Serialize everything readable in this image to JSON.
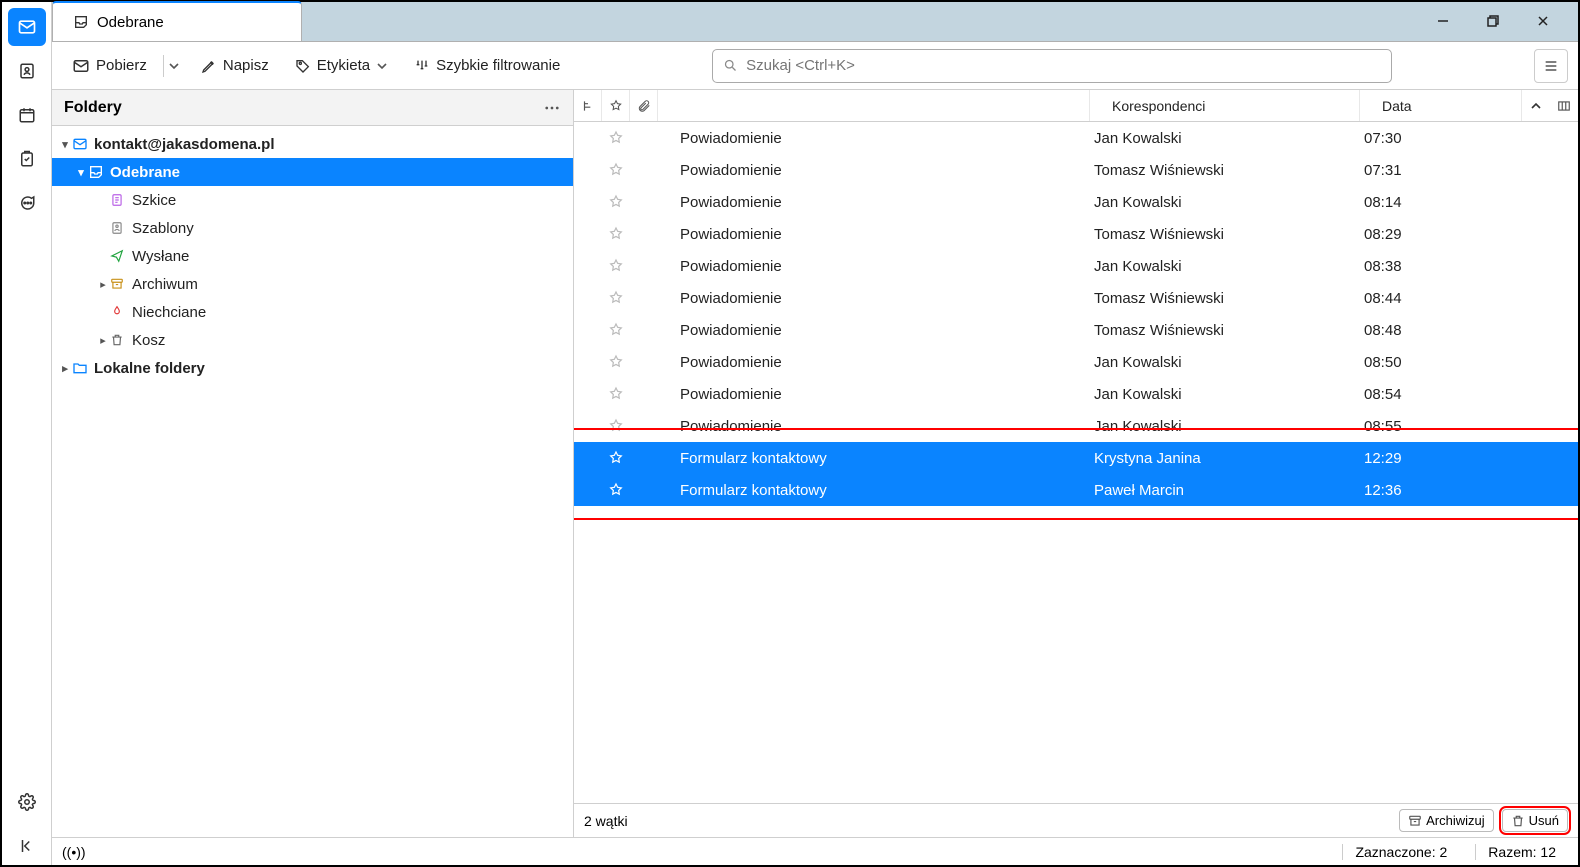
{
  "tab_title": "Odebrane",
  "toolbar": {
    "get": "Pobierz",
    "write": "Napisz",
    "tag": "Etykieta",
    "quick_filter": "Szybkie filtrowanie",
    "search_placeholder": "Szukaj <Ctrl+K>"
  },
  "folders": {
    "header": "Foldery",
    "account": "kontakt@jakasdomena.pl",
    "inbox": "Odebrane",
    "drafts": "Szkice",
    "templates": "Szablony",
    "sent": "Wysłane",
    "archive": "Archiwum",
    "junk": "Niechciane",
    "trash": "Kosz",
    "local": "Lokalne foldery"
  },
  "headers": {
    "correspondents": "Korespondenci",
    "date": "Data"
  },
  "messages": [
    {
      "subject": "Powiadomienie",
      "from": "Jan Kowalski",
      "date": "07:30",
      "selected": false
    },
    {
      "subject": "Powiadomienie",
      "from": "Tomasz Wiśniewski",
      "date": "07:31",
      "selected": false
    },
    {
      "subject": "Powiadomienie",
      "from": "Jan Kowalski",
      "date": "08:14",
      "selected": false
    },
    {
      "subject": "Powiadomienie",
      "from": "Tomasz Wiśniewski",
      "date": "08:29",
      "selected": false
    },
    {
      "subject": "Powiadomienie",
      "from": "Jan Kowalski",
      "date": "08:38",
      "selected": false
    },
    {
      "subject": "Powiadomienie",
      "from": "Tomasz Wiśniewski",
      "date": "08:44",
      "selected": false
    },
    {
      "subject": "Powiadomienie",
      "from": "Tomasz Wiśniewski",
      "date": "08:48",
      "selected": false
    },
    {
      "subject": "Powiadomienie",
      "from": "Jan Kowalski",
      "date": "08:50",
      "selected": false
    },
    {
      "subject": "Powiadomienie",
      "from": "Jan Kowalski",
      "date": "08:54",
      "selected": false
    },
    {
      "subject": "Powiadomienie",
      "from": "Jan Kowalski",
      "date": "08:55",
      "selected": false
    },
    {
      "subject": "Formularz kontaktowy",
      "from": "Krystyna Janina",
      "date": "12:29",
      "selected": true
    },
    {
      "subject": "Formularz kontaktowy",
      "from": "Paweł Marcin",
      "date": "12:36",
      "selected": true
    }
  ],
  "footer": {
    "threads": "2 wątki",
    "archive": "Archiwizuj",
    "delete": "Usuń"
  },
  "status": {
    "selected_label": "Zaznaczone:",
    "selected_count": "2",
    "total_label": "Razem:",
    "total_count": "12"
  }
}
